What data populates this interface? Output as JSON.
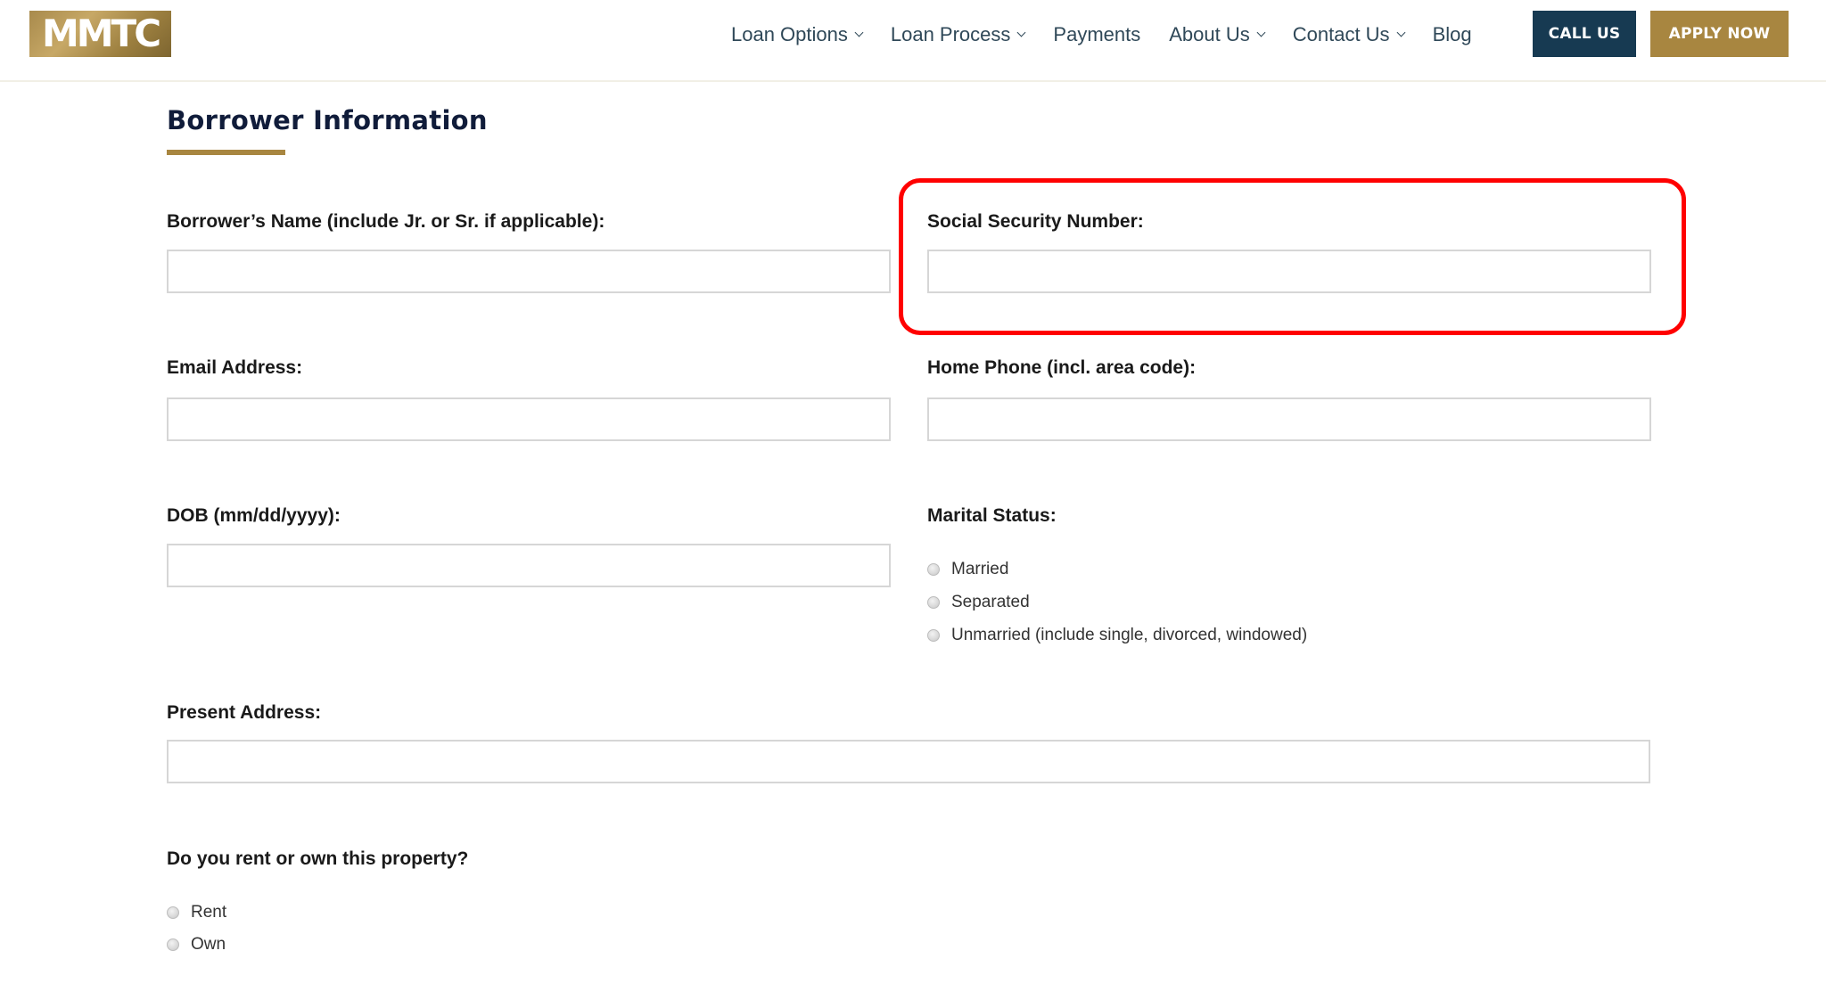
{
  "header": {
    "logo_text": "MMTC",
    "nav": [
      {
        "label": "Loan Options",
        "has_dropdown": true
      },
      {
        "label": "Loan Process",
        "has_dropdown": true
      },
      {
        "label": "Payments",
        "has_dropdown": false
      },
      {
        "label": "About Us",
        "has_dropdown": true
      },
      {
        "label": "Contact Us",
        "has_dropdown": true
      },
      {
        "label": "Blog",
        "has_dropdown": false
      }
    ],
    "call_button": "CALL US",
    "apply_button": "APPLY NOW"
  },
  "colors": {
    "brand_gold": "#a88640",
    "brand_navy": "#173a52",
    "heading_navy": "#101c3a",
    "highlight_red": "#ff0000"
  },
  "form": {
    "section_title": "Borrower Information",
    "fields": {
      "borrower_name": {
        "label": "Borrower’s Name (include Jr. or Sr. if applicable):",
        "value": "",
        "placeholder": ""
      },
      "ssn": {
        "label": "Social Security Number:",
        "value": "",
        "placeholder": ""
      },
      "email": {
        "label": "Email Address:",
        "value": "",
        "placeholder": ""
      },
      "home_phone": {
        "label": "Home Phone (incl. area code):",
        "value": "",
        "placeholder": ""
      },
      "dob": {
        "label": "DOB (mm/dd/yyyy):",
        "value": "",
        "placeholder": ""
      },
      "present_address": {
        "label": "Present Address:",
        "value": "",
        "placeholder": ""
      }
    },
    "marital_status": {
      "label": "Marital Status:",
      "options": [
        "Married",
        "Separated",
        "Unmarried (include single, divorced, windowed)"
      ],
      "selected": null
    },
    "rent_or_own": {
      "label": "Do you rent or own this property?",
      "options": [
        "Rent",
        "Own"
      ],
      "selected": null
    }
  },
  "annotation": {
    "highlighted_field": "ssn"
  }
}
